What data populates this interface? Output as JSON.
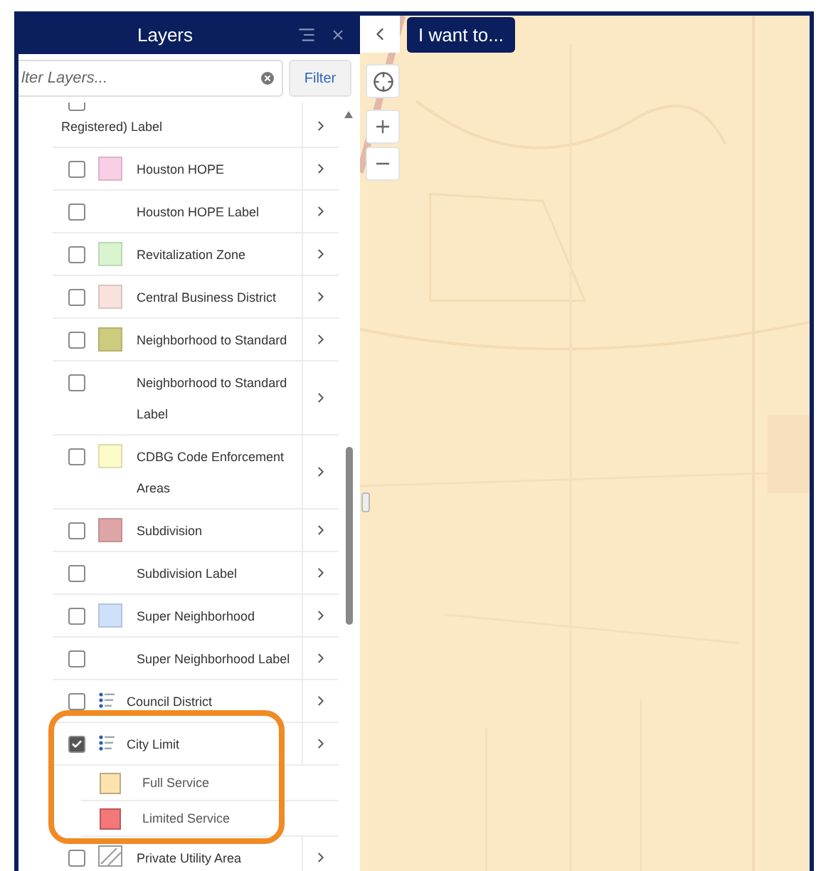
{
  "panel": {
    "title": "Layers",
    "search": {
      "placeholder": "lter Layers..."
    },
    "filter_button": "Filter"
  },
  "layers": [
    {
      "kind": "continued",
      "label": "Registered) Label",
      "checked": false
    },
    {
      "kind": "swatch",
      "label": "Houston HOPE",
      "checked": false,
      "color": "#f9cfe6"
    },
    {
      "kind": "plain",
      "label": "Houston HOPE Label",
      "checked": false
    },
    {
      "kind": "swatch",
      "label": "Revitalization Zone",
      "checked": false,
      "color": "#d9f5cf"
    },
    {
      "kind": "swatch",
      "label": "Central Business District",
      "checked": false,
      "color": "#f9e1dc"
    },
    {
      "kind": "swatch",
      "label": "Neighborhood to Standard",
      "checked": false,
      "color": "#cccb7e"
    },
    {
      "kind": "plain",
      "label": "Neighborhood to Standard Label",
      "checked": false
    },
    {
      "kind": "swatch",
      "label": "CDBG Code Enforcement Areas",
      "checked": false,
      "color": "#fbfbc8"
    },
    {
      "kind": "swatch",
      "label": "Subdivision",
      "checked": false,
      "color": "#dea5a7"
    },
    {
      "kind": "plain",
      "label": "Subdivision Label",
      "checked": false
    },
    {
      "kind": "swatch",
      "label": "Super Neighborhood",
      "checked": false,
      "color": "#cfe0fb"
    },
    {
      "kind": "plain",
      "label": "Super Neighborhood Label",
      "checked": false
    },
    {
      "kind": "legend",
      "label": "Council District",
      "checked": false
    },
    {
      "kind": "legend",
      "label": "City Limit",
      "checked": true,
      "children": [
        {
          "label": "Full Service",
          "color": "#fce3ad"
        },
        {
          "label": "Limited Service",
          "color": "#f47779"
        }
      ]
    },
    {
      "kind": "hatch",
      "label": "Private Utility Area",
      "checked": false
    }
  ],
  "map": {
    "i_want_to_button": "I want to..."
  }
}
